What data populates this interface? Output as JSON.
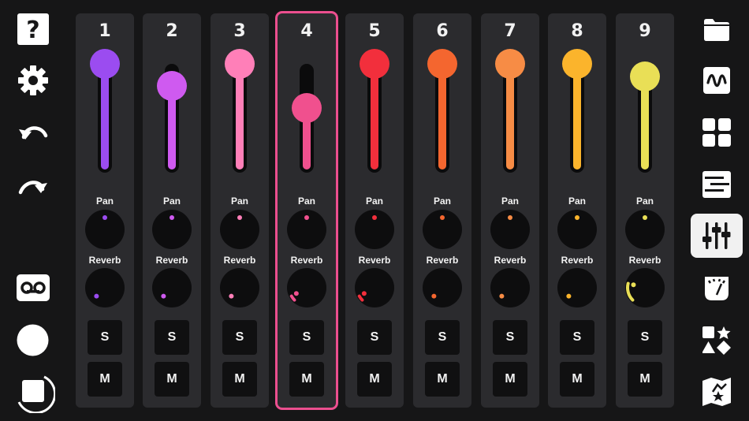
{
  "accent": "#ec4f8f",
  "left_toolbar": [
    {
      "icon": "help-icon"
    },
    {
      "icon": "gear-icon"
    },
    {
      "icon": "undo-icon"
    },
    {
      "icon": "redo-icon"
    },
    {
      "icon": "tape-icon"
    },
    {
      "icon": "record-icon"
    },
    {
      "icon": "stop-icon"
    }
  ],
  "right_toolbar": [
    {
      "icon": "folder-icon",
      "active": false
    },
    {
      "icon": "waveform-icon",
      "active": false
    },
    {
      "icon": "pads-grid-icon",
      "active": false
    },
    {
      "icon": "piano-roll-icon",
      "active": false
    },
    {
      "icon": "mixer-icon",
      "active": true
    },
    {
      "icon": "meter-icon",
      "active": false
    },
    {
      "icon": "shapes-icon",
      "active": false
    },
    {
      "icon": "map-star-icon",
      "active": false
    }
  ],
  "knob_labels": {
    "pan": "Pan",
    "reverb": "Reverb"
  },
  "button_labels": {
    "solo": "S",
    "mute": "M"
  },
  "channels": [
    {
      "number": "1",
      "color": "#9b4cf0",
      "volume": 1.0,
      "pan": 0.5,
      "reverb": 0.0,
      "selected": false
    },
    {
      "number": "2",
      "color": "#cf5af0",
      "volume": 0.68,
      "pan": 0.5,
      "reverb": 0.0,
      "selected": false
    },
    {
      "number": "3",
      "color": "#ff7fb8",
      "volume": 1.0,
      "pan": 0.5,
      "reverb": 0.0,
      "selected": false
    },
    {
      "number": "4",
      "color": "#f0508e",
      "volume": 0.36,
      "pan": 0.5,
      "reverb": 0.06,
      "selected": true
    },
    {
      "number": "5",
      "color": "#f22f3c",
      "volume": 1.0,
      "pan": 0.5,
      "reverb": 0.06,
      "selected": false
    },
    {
      "number": "6",
      "color": "#f4662f",
      "volume": 1.0,
      "pan": 0.5,
      "reverb": 0.0,
      "selected": false
    },
    {
      "number": "7",
      "color": "#f78c45",
      "volume": 1.0,
      "pan": 0.5,
      "reverb": 0.0,
      "selected": false
    },
    {
      "number": "8",
      "color": "#fbb42c",
      "volume": 1.0,
      "pan": 0.5,
      "reverb": 0.0,
      "selected": false
    },
    {
      "number": "9",
      "color": "#e9df56",
      "volume": 0.82,
      "pan": 0.5,
      "reverb": 0.22,
      "selected": false
    }
  ]
}
